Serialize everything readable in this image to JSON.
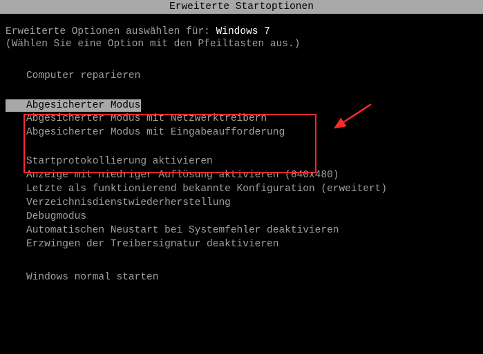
{
  "title": "Erweiterte Startoptionen",
  "intro": {
    "prefix": "Erweiterte Optionen auswählen für:",
    "os": "Windows 7",
    "hint": "(Wählen Sie eine Option mit den Pfeiltasten aus.)"
  },
  "groups": {
    "repair": {
      "item": "Computer reparieren"
    },
    "safemodes": {
      "item0": "Abgesicherter Modus",
      "item1": "Abgesicherter Modus mit Netzwerktreibern",
      "item2": "Abgesicherter Modus mit Eingabeaufforderung"
    },
    "advanced": {
      "item0": "Startprotokollierung aktivieren",
      "item1": "Anzeige mit niedriger Auflösung aktivieren (640x480)",
      "item2": "Letzte als funktionierend bekannte Konfiguration (erweitert)",
      "item3": "Verzeichnisdienstwiederherstellung",
      "item4": "Debugmodus",
      "item5": "Automatischen Neustart bei Systemfehler deaktivieren",
      "item6": "Erzwingen der Treibersignatur deaktivieren"
    },
    "normal": {
      "item": "Windows normal starten"
    }
  },
  "annotation": {
    "arrow_color": "#ff2a2a",
    "box_color": "#ff2a2a"
  }
}
